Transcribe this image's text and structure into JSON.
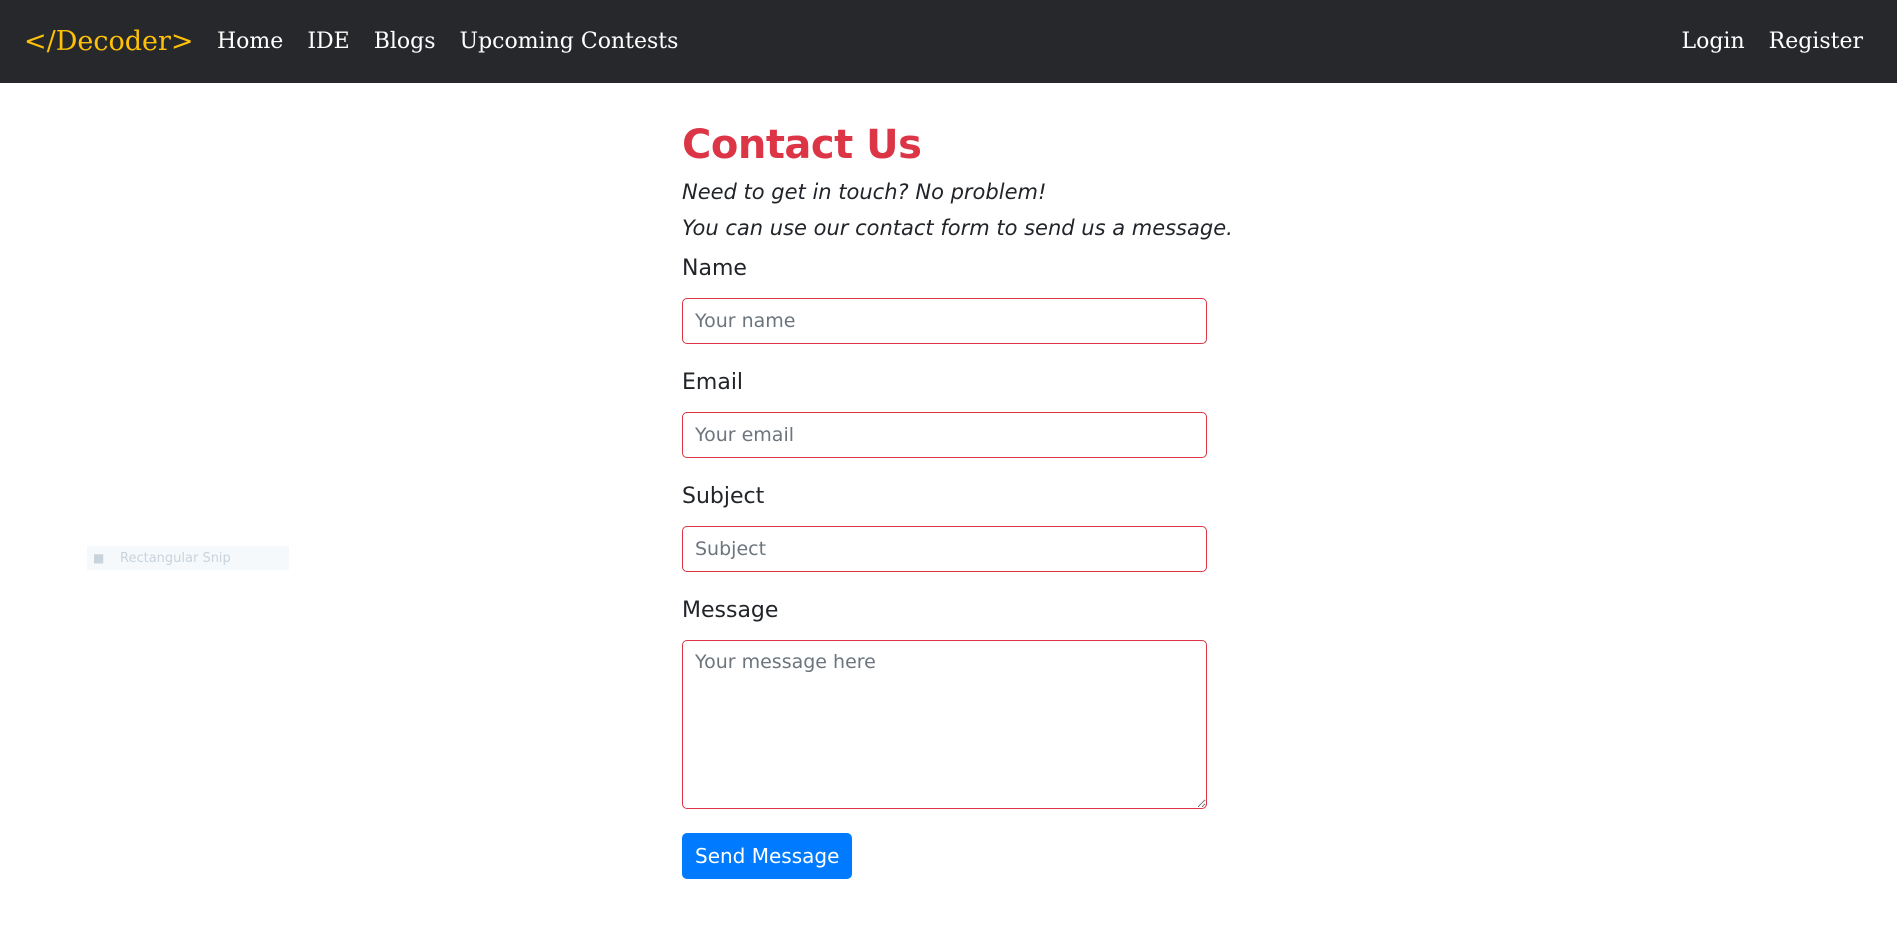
{
  "navbar": {
    "brand": "</Decoder>",
    "left_links": [
      "Home",
      "IDE",
      "Blogs",
      "Upcoming Contests"
    ],
    "right_links": [
      "Login",
      "Register"
    ]
  },
  "main": {
    "title": "Contact Us",
    "lead_line1": "Need to get in touch? No problem!",
    "lead_line2": "You can use our contact form to send us a message.",
    "fields": {
      "name": {
        "label": "Name",
        "placeholder": "Your name",
        "value": ""
      },
      "email": {
        "label": "Email",
        "placeholder": "Your email",
        "value": ""
      },
      "subject": {
        "label": "Subject",
        "placeholder": "Subject",
        "value": ""
      },
      "message": {
        "label": "Message",
        "placeholder": "Your message here",
        "value": ""
      }
    },
    "send_button": "Send Message"
  },
  "overlay": {
    "snip_label": "Rectangular Snip",
    "snip_icon": "snip-icon"
  },
  "colors": {
    "navbar_bg": "#26282b",
    "brand": "#ffc107",
    "title": "#dc3545",
    "input_border": "#dc3545",
    "button": "#007bff"
  }
}
